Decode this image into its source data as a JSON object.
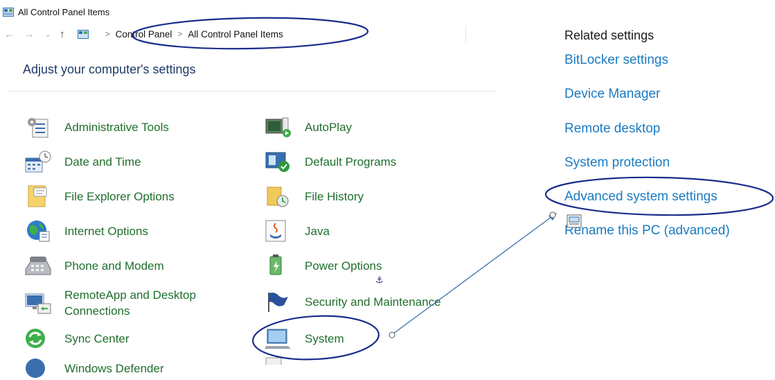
{
  "window": {
    "title": "All Control Panel Items",
    "icon": "control-panel-icon"
  },
  "nav": {
    "back_icon": "←",
    "forward_icon": "→",
    "dropdown_icon": "⌄",
    "up_icon": "↑",
    "breadcrumb": [
      "Control Panel",
      "All Control Panel Items"
    ],
    "separator": ">"
  },
  "main": {
    "heading": "Adjust your computer's settings",
    "items_col1": [
      {
        "label": "Administrative Tools",
        "icon": "administrative-tools-icon"
      },
      {
        "label": "Date and Time",
        "icon": "date-time-icon"
      },
      {
        "label": "File Explorer Options",
        "icon": "folder-options-icon"
      },
      {
        "label": "Internet Options",
        "icon": "internet-options-icon"
      },
      {
        "label": "Phone and Modem",
        "icon": "phone-modem-icon"
      },
      {
        "label": "RemoteApp and Desktop Connections",
        "line1": "RemoteApp and Desktop",
        "line2": "Connections",
        "icon": "remoteapp-icon"
      },
      {
        "label": "Sync Center",
        "icon": "sync-center-icon"
      },
      {
        "label": "Windows Defender",
        "icon": "windows-defender-icon"
      }
    ],
    "items_col2": [
      {
        "label": "AutoPlay",
        "icon": "autoplay-icon"
      },
      {
        "label": "Default Programs",
        "icon": "default-programs-icon"
      },
      {
        "label": "File History",
        "icon": "file-history-icon"
      },
      {
        "label": "Java",
        "icon": "java-icon"
      },
      {
        "label": "Power Options",
        "icon": "power-options-icon"
      },
      {
        "label": "Security and Maintenance",
        "icon": "security-flag-icon"
      },
      {
        "label": "System",
        "icon": "system-icon"
      }
    ]
  },
  "related": {
    "title": "Related settings",
    "links": [
      "BitLocker settings",
      "Device Manager",
      "Remote desktop",
      "System protection",
      "Advanced system settings",
      "Rename this PC (advanced)"
    ]
  },
  "colors": {
    "item_text": "#1f6f2c",
    "link": "#1a7bc0",
    "heading": "#1e3a66",
    "annotation": "#1a2c8c",
    "arrow": "#3a6fae"
  }
}
